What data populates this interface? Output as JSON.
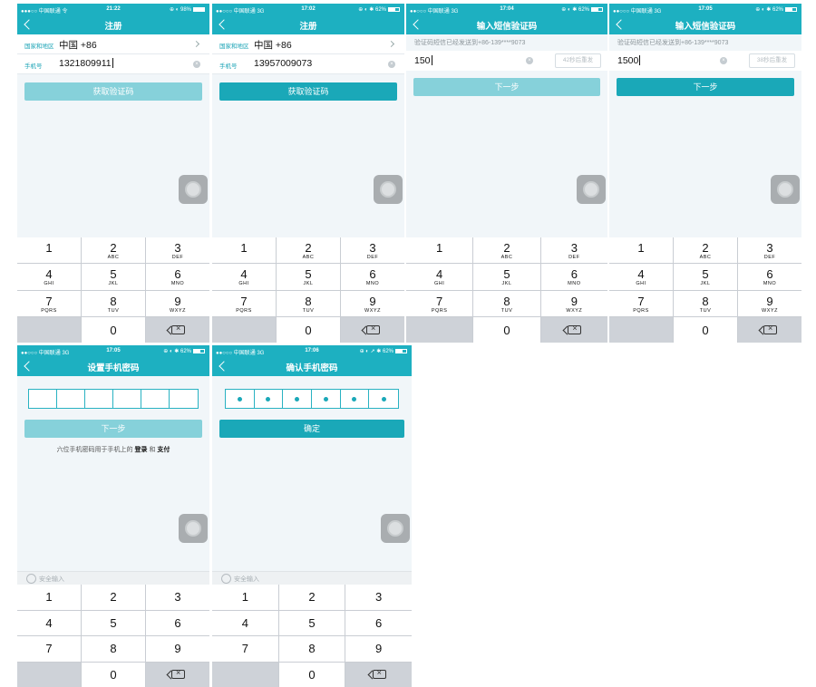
{
  "screens": [
    {
      "carrier": "●●●○○ 中国联通 令",
      "time": "21:22",
      "status_right": "⊕ ◐ 98%",
      "battery": 0.98,
      "title": "注册",
      "region_label": "国家和地区",
      "region_value": "中国 +86",
      "phone_label": "手机号",
      "phone_value": "1321809911",
      "button": "获取验证码"
    },
    {
      "carrier": "●●○○○ 中国联通 3G",
      "time": "17:02",
      "status_right": "⊕ ◐ ✱ 62%",
      "battery": 0.62,
      "title": "注册",
      "region_label": "国家和地区",
      "region_value": "中国 +86",
      "phone_label": "手机号",
      "phone_value": "13957009073",
      "button": "获取验证码"
    },
    {
      "carrier": "●●○○○ 中国联通 3G",
      "time": "17:04",
      "status_right": "⊕ ◐ ✱ 62%",
      "battery": 0.62,
      "title": "输入短信验证码",
      "hint": "验证码短信已经发送到+86-139****9073",
      "code_value": "150",
      "resend": "42秒后重发",
      "button": "下一步"
    },
    {
      "carrier": "●●○○○ 中国联通 3G",
      "time": "17:05",
      "status_right": "⊕ ◐ ✱ 62%",
      "battery": 0.62,
      "title": "输入短信验证码",
      "hint": "验证码短信已经发送到+86-139****9073",
      "code_value": "1500",
      "resend": "38秒后重发",
      "button": "下一步"
    },
    {
      "carrier": "●●○○○ 中国联通 3G",
      "time": "17:05",
      "status_right": "⊕ ◐ ✱ 62%",
      "battery": 0.62,
      "title": "设置手机密码",
      "button": "下一步",
      "note_prefix": "六位手机密码用于手机上的",
      "note_login": "登录",
      "note_and": "和",
      "note_pay": "支付",
      "secure": "安全输入"
    },
    {
      "carrier": "●●○○○ 中国联通 3G",
      "time": "17:06",
      "status_right": "⊕ ◐ ➚ ✱ 62%",
      "battery": 0.62,
      "title": "确认手机密码",
      "button": "确定",
      "secure": "安全输入"
    }
  ],
  "keypad_phone": {
    "keys": [
      {
        "d": "1",
        "l": ""
      },
      {
        "d": "2",
        "l": "ABC"
      },
      {
        "d": "3",
        "l": "DEF"
      },
      {
        "d": "4",
        "l": "GHI"
      },
      {
        "d": "5",
        "l": "JKL"
      },
      {
        "d": "6",
        "l": "MNO"
      },
      {
        "d": "7",
        "l": "PQRS"
      },
      {
        "d": "8",
        "l": "TUV"
      },
      {
        "d": "9",
        "l": "WXYZ"
      },
      {
        "d": "",
        "l": ""
      },
      {
        "d": "0",
        "l": ""
      },
      {
        "d": "",
        "l": ""
      }
    ]
  },
  "keypad_secure": {
    "keys": [
      "1",
      "2",
      "3",
      "4",
      "5",
      "6",
      "7",
      "8",
      "9",
      "",
      "0",
      ""
    ]
  },
  "theme": {
    "accent": "#1db0c1",
    "button_active": "#1aa8b8",
    "button_disabled": "#86d1da"
  }
}
